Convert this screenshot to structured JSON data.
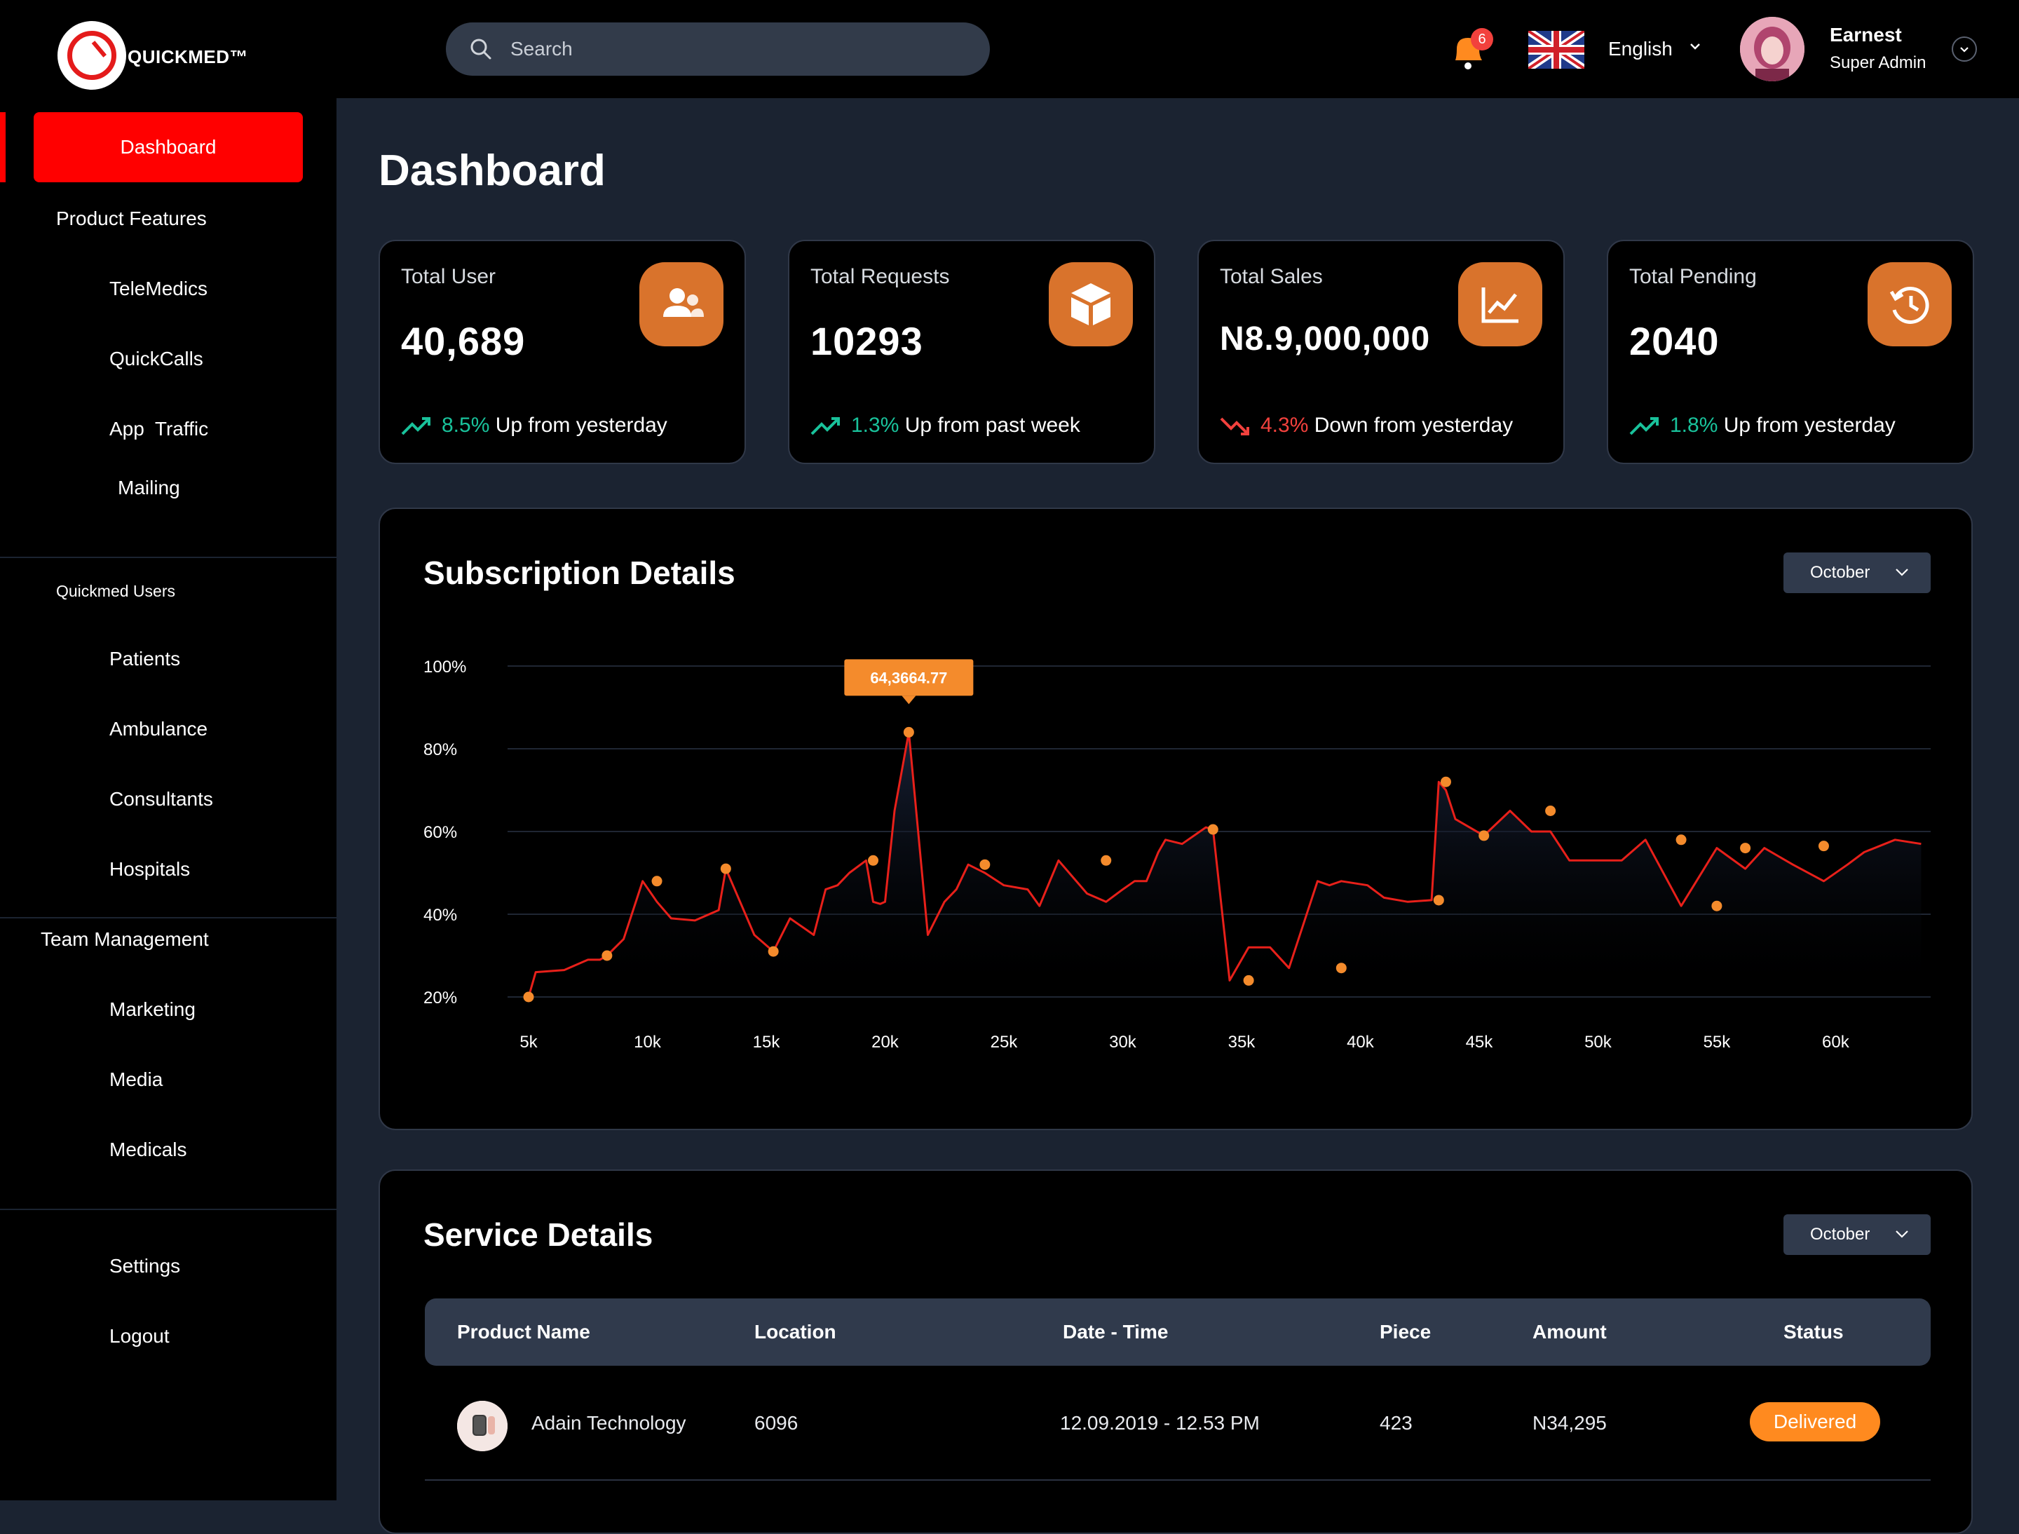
{
  "app": {
    "logo_text": "QUICKMED™",
    "search_placeholder": "Search",
    "notifications_count": "6",
    "language": "English",
    "user_name": "Earnest",
    "user_role": "Super Admin"
  },
  "sidebar": {
    "items": [
      {
        "label": "Dashboard"
      },
      {
        "label": "Product Features"
      },
      {
        "label": "TeleMedics"
      },
      {
        "label": "QuickCalls"
      },
      {
        "label": "App  Traffic"
      },
      {
        "label": "Mailing"
      },
      {
        "label": "Quickmed Users"
      },
      {
        "label": "Patients"
      },
      {
        "label": "Ambulance"
      },
      {
        "label": "Consultants"
      },
      {
        "label": "Hospitals"
      },
      {
        "label": "Team Management"
      },
      {
        "label": "Marketing"
      },
      {
        "label": "Media"
      },
      {
        "label": "Medicals"
      },
      {
        "label": "Settings"
      },
      {
        "label": "Logout"
      }
    ]
  },
  "page": {
    "title": "Dashboard"
  },
  "cards": [
    {
      "label": "Total User",
      "value": "40,689",
      "pct": "8.5%",
      "trend_text": " Up from yesterday",
      "direction": "up",
      "icon": "users-icon"
    },
    {
      "label": "Total Requests",
      "value": "10293",
      "pct": "1.3%",
      "trend_text": " Up from past week",
      "direction": "up",
      "icon": "box-icon"
    },
    {
      "label": "Total Sales",
      "value": "N8.9,000,000",
      "pct": "4.3%",
      "trend_text": " Down from yesterday",
      "direction": "down",
      "icon": "line-chart-icon"
    },
    {
      "label": "Total Pending",
      "value": "2040",
      "pct": "1.8%",
      "trend_text": " Up from yesterday",
      "direction": "up",
      "icon": "history-icon"
    }
  ],
  "subscription": {
    "title": "Subscription Details",
    "month": "October"
  },
  "chart_data": {
    "type": "line",
    "title": "Subscription Details",
    "xlabel": "",
    "ylabel": "",
    "x_ticks": [
      "5k",
      "10k",
      "15k",
      "20k",
      "25k",
      "30k",
      "35k",
      "40k",
      "45k",
      "50k",
      "55k",
      "60k"
    ],
    "y_ticks": [
      "100%",
      "80%",
      "60%",
      "40%",
      "20%"
    ],
    "xlim": [
      5000,
      64000
    ],
    "ylim": [
      20,
      100
    ],
    "grid": true,
    "tooltip": {
      "x": 21000,
      "label": "64,3664.77"
    },
    "series": [
      {
        "color": "#e8201a",
        "marker_color": "#f48b2c",
        "x": [
          5000,
          5300,
          6500,
          7500,
          8000,
          8300,
          9000,
          9800,
          10400,
          11000,
          12000,
          13000,
          13300,
          14500,
          15300,
          16000,
          17000,
          17500,
          18000,
          18500,
          19200,
          19500,
          19800,
          20000,
          20400,
          21000,
          21800,
          22500,
          23000,
          23500,
          24200,
          25000,
          26000,
          26500,
          27300,
          28500,
          29300,
          30000,
          30500,
          31000,
          31500,
          31800,
          32500,
          33500,
          33800,
          34500,
          35300,
          36200,
          37000,
          38200,
          38700,
          39200,
          40300,
          41000,
          42000,
          43000,
          43300,
          43600,
          44000,
          45200,
          46300,
          47200,
          48000,
          48800,
          49800,
          51000,
          52000,
          53500,
          55000,
          56200,
          57000,
          58200,
          59500,
          60500,
          61200,
          62500,
          63600
        ],
        "y": [
          20,
          26,
          26.5,
          29,
          29,
          30,
          34,
          48,
          43,
          39,
          38.5,
          41,
          51,
          35,
          31,
          39,
          35,
          46,
          47,
          50,
          53,
          43,
          42.5,
          43,
          65,
          84,
          35,
          43,
          46,
          52,
          50,
          47,
          46,
          42,
          53,
          45,
          43,
          46,
          48,
          48,
          55,
          58,
          57,
          61,
          60.5,
          24,
          32,
          32,
          27,
          48,
          47,
          48,
          47,
          44,
          43,
          43.4,
          72,
          70,
          63,
          59,
          65,
          60,
          60,
          53,
          53,
          53,
          58,
          42,
          56,
          51,
          56,
          52,
          48,
          52,
          55,
          58,
          57
        ]
      }
    ],
    "markers_x": [
      5000,
      8300,
      10400,
      13300,
      15300,
      19500,
      21000,
      24200,
      29300,
      33800,
      35300,
      39200,
      43300,
      43600,
      45200,
      48000,
      53500,
      55000,
      56200,
      59500
    ],
    "markers_y": [
      20,
      30,
      48,
      51,
      31,
      53,
      84,
      52,
      53,
      60.5,
      24,
      27,
      43.4,
      72,
      59,
      65,
      58,
      42,
      56,
      56.5
    ]
  },
  "service": {
    "title": "Service Details",
    "month": "October",
    "columns": [
      "Product Name",
      "Location",
      "Date - Time",
      "Piece",
      "Amount",
      "Status"
    ],
    "rows": [
      {
        "product": "Adain Technology",
        "location": "6096",
        "datetime": "12.09.2019 - 12.53 PM",
        "piece": "423",
        "amount": "N34,295",
        "status": "Delivered"
      }
    ]
  },
  "colors": {
    "accent_red": "#ff0000",
    "card_icon_orange": "#d9732c",
    "trend_up": "#19c29b",
    "trend_down": "#f2413d",
    "status_orange": "#ff8a1f"
  }
}
